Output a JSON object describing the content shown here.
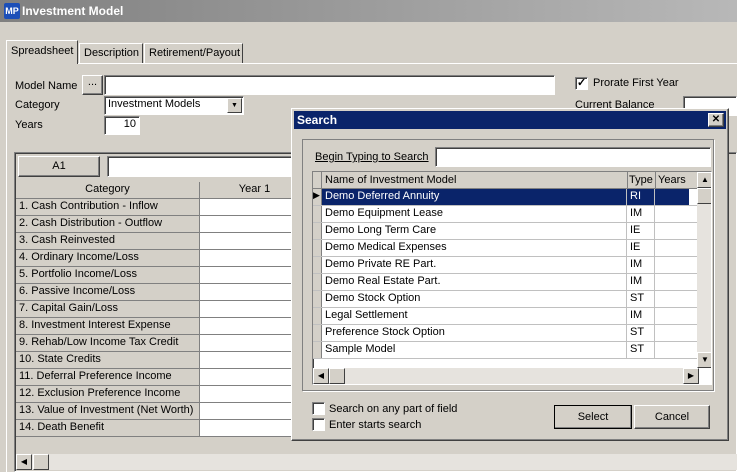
{
  "window": {
    "title": "Investment Model",
    "app_icon": "mp-logo-icon"
  },
  "tabs": [
    {
      "label": "Spreadsheet",
      "active": true
    },
    {
      "label": "Description",
      "active": false
    },
    {
      "label": "Retirement/Payout",
      "active": false
    }
  ],
  "form": {
    "model_name_label": "Model Name",
    "model_name_button": "...",
    "model_name_value": "",
    "category_label": "Category",
    "category_value": "Investment Models",
    "years_label": "Years",
    "years_value": "10",
    "prorate_label": "Prorate First Year",
    "prorate_checked": true,
    "current_balance_label": "Current Balance"
  },
  "sheet": {
    "cell_ref": "A1",
    "formula_value": "",
    "columns": [
      "Category",
      "Year 1"
    ],
    "rows": [
      "1. Cash Contribution - Inflow",
      "2. Cash Distribution - Outflow",
      "3. Cash Reinvested",
      "4. Ordinary Income/Loss",
      "5. Portfolio Income/Loss",
      "6. Passive Income/Loss",
      "7. Capital Gain/Loss",
      "8. Investment Interest Expense",
      "9. Rehab/Low Income Tax Credit",
      "10. State Credits",
      "11. Deferral Preference Income",
      "12. Exclusion Preference Income",
      "13. Value of Investment (Net Worth)",
      "14. Death Benefit"
    ]
  },
  "search_dialog": {
    "title": "Search",
    "prompt_label": "Begin Typing to Search",
    "search_value": "",
    "columns": [
      "Name of Investment Model",
      "Type",
      "Years"
    ],
    "items": [
      {
        "name": "Demo Deferred Annuity",
        "type": "RI",
        "years": "",
        "selected": true
      },
      {
        "name": "Demo Equipment Lease",
        "type": "IM",
        "years": ""
      },
      {
        "name": "Demo Long Term Care",
        "type": "IE",
        "years": ""
      },
      {
        "name": "Demo Medical Expenses",
        "type": "IE",
        "years": ""
      },
      {
        "name": "Demo Private RE Part.",
        "type": "IM",
        "years": ""
      },
      {
        "name": "Demo Real Estate Part.",
        "type": "IM",
        "years": ""
      },
      {
        "name": "Demo Stock Option",
        "type": "ST",
        "years": ""
      },
      {
        "name": "Legal Settlement",
        "type": "IM",
        "years": ""
      },
      {
        "name": "Preference Stock Option",
        "type": "ST",
        "years": ""
      },
      {
        "name": "Sample Model",
        "type": "ST",
        "years": ""
      }
    ],
    "opt_any_part": "Search on any part of field",
    "opt_enter_starts": "Enter starts search",
    "select_button": "Select",
    "cancel_button": "Cancel"
  },
  "colors": {
    "selection": "#0a246a",
    "face": "#d4d0c8"
  }
}
